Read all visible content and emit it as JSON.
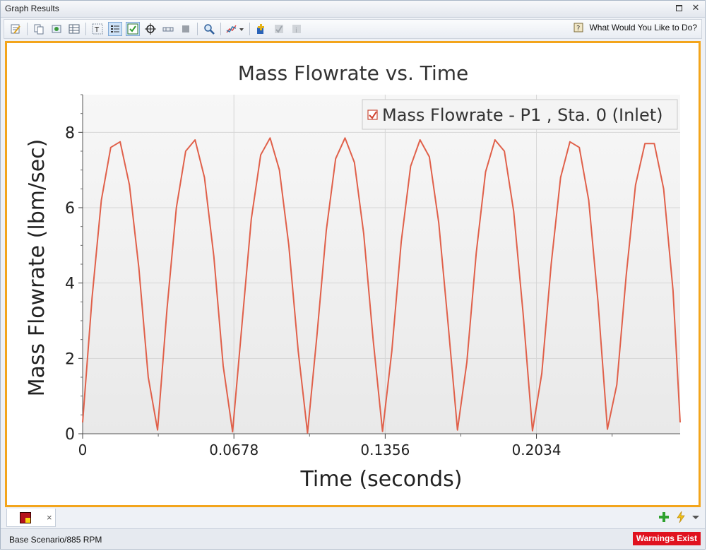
{
  "window": {
    "title": "Graph Results"
  },
  "toolbar": {
    "help_label": "What Would You Like to Do?"
  },
  "tabs": [
    {
      "close": "×"
    }
  ],
  "status": {
    "scenario": "Base Scenario/885 RPM",
    "warnings": "Warnings Exist",
    "warnings_color": "#e0121f"
  },
  "colors": {
    "accent_border": "#f3a51c",
    "series": "#e0604a"
  },
  "chart_data": {
    "type": "line",
    "title": "Mass Flowrate vs. Time",
    "xlabel": "Time (seconds)",
    "ylabel": "Mass Flowrate (lbm/sec)",
    "xlim": [
      0,
      0.2678
    ],
    "ylim": [
      0,
      9
    ],
    "xticks": [
      0,
      0.0678,
      0.1356,
      0.2034
    ],
    "xtick_labels": [
      "0",
      "0.0678",
      "0.1356",
      "0.2034"
    ],
    "yticks": [
      0,
      2,
      4,
      6,
      8
    ],
    "ytick_labels": [
      "0",
      "2",
      "4",
      "6",
      "8"
    ],
    "grid": true,
    "legend_position": "top-right",
    "series": [
      {
        "name": "Mass Flowrate - P1 , Sta. 0 (Inlet)",
        "color": "#e0604a",
        "x": [
          0,
          0.0042,
          0.0084,
          0.0126,
          0.0168,
          0.021,
          0.0252,
          0.0294,
          0.0336,
          0.0378,
          0.042,
          0.0462,
          0.0504,
          0.0546,
          0.0588,
          0.063,
          0.0672,
          0.0714,
          0.0756,
          0.0798,
          0.084,
          0.0882,
          0.0924,
          0.0966,
          0.1008,
          0.105,
          0.1092,
          0.1134,
          0.1176,
          0.1218,
          0.126,
          0.1302,
          0.1344,
          0.1386,
          0.1428,
          0.147,
          0.1512,
          0.1554,
          0.1596,
          0.1638,
          0.168,
          0.1722,
          0.1764,
          0.1806,
          0.1848,
          0.189,
          0.1932,
          0.1974,
          0.2016,
          0.2058,
          0.21,
          0.2142,
          0.2184,
          0.2226,
          0.2268,
          0.231,
          0.2352,
          0.2394,
          0.2436,
          0.2478,
          0.252,
          0.2562,
          0.2604,
          0.2646,
          0.2678
        ],
        "y": [
          0.3,
          3.6,
          6.2,
          7.6,
          7.75,
          6.6,
          4.4,
          1.5,
          0.1,
          3.3,
          6.0,
          7.5,
          7.8,
          6.8,
          4.7,
          1.8,
          0.05,
          2.9,
          5.7,
          7.4,
          7.85,
          7.0,
          5.0,
          2.2,
          0.02,
          2.6,
          5.4,
          7.3,
          7.85,
          7.2,
          5.3,
          2.5,
          0.06,
          2.2,
          5.1,
          7.1,
          7.8,
          7.35,
          5.6,
          2.9,
          0.1,
          1.9,
          4.8,
          6.95,
          7.8,
          7.5,
          5.9,
          3.2,
          0.08,
          1.6,
          4.5,
          6.8,
          7.75,
          7.6,
          6.2,
          3.5,
          0.12,
          1.3,
          4.2,
          6.6,
          7.7,
          7.7,
          6.5,
          3.8,
          0.3
        ]
      }
    ]
  }
}
